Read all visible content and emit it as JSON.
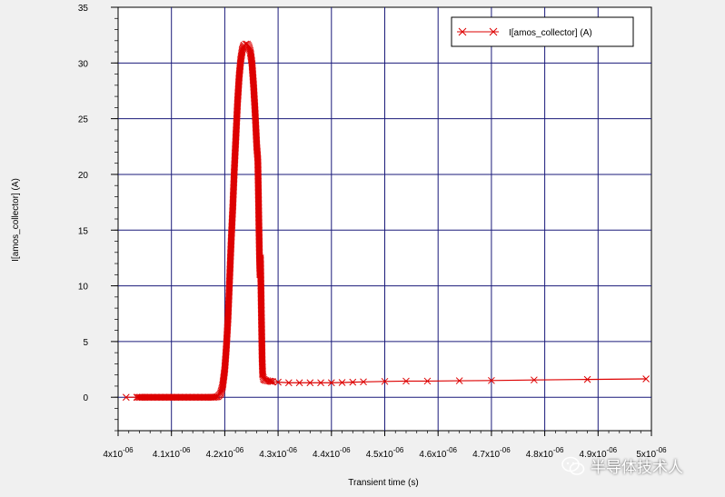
{
  "chart_data": {
    "type": "line",
    "title": "",
    "xlabel": "Transient time (s)",
    "ylabel": "I[amos_collector] (A)",
    "xlim": [
      4e-06,
      5e-06
    ],
    "ylim": [
      -3,
      35
    ],
    "x_ticks": [
      {
        "mantissa": "4x10",
        "exp": "-06"
      },
      {
        "mantissa": "4.1x10",
        "exp": "-06"
      },
      {
        "mantissa": "4.2x10",
        "exp": "-06"
      },
      {
        "mantissa": "4.3x10",
        "exp": "-06"
      },
      {
        "mantissa": "4.4x10",
        "exp": "-06"
      },
      {
        "mantissa": "4.5x10",
        "exp": "-06"
      },
      {
        "mantissa": "4.6x10",
        "exp": "-06"
      },
      {
        "mantissa": "4.7x10",
        "exp": "-06"
      },
      {
        "mantissa": "4.8x10",
        "exp": "-06"
      },
      {
        "mantissa": "4.9x10",
        "exp": "-06"
      },
      {
        "mantissa": "5x10",
        "exp": "-06"
      }
    ],
    "y_ticks": [
      "0",
      "5",
      "10",
      "15",
      "20",
      "25",
      "30",
      "35"
    ],
    "grid": true,
    "legend": "top-right",
    "series": [
      {
        "name": "I[amos_collector] (A)",
        "color": "#dd0000",
        "marker": "x",
        "points": [
          [
            4.015e-06,
            0.0
          ],
          [
            4.035e-06,
            0.0
          ],
          [
            4.05e-06,
            0.0
          ],
          [
            4.07e-06,
            0.0
          ],
          [
            4.09e-06,
            0.0
          ],
          [
            4.11e-06,
            0.0
          ],
          [
            4.13e-06,
            0.0
          ],
          [
            4.15e-06,
            0.0
          ],
          [
            4.17e-06,
            0.0
          ],
          [
            4.18e-06,
            0.0
          ],
          [
            4.187e-06,
            0.05
          ],
          [
            4.192e-06,
            0.3
          ],
          [
            4.196e-06,
            1.0
          ],
          [
            4.2e-06,
            2.5
          ],
          [
            4.203e-06,
            4.5
          ],
          [
            4.206e-06,
            7.0
          ],
          [
            4.209e-06,
            10.5
          ],
          [
            4.212e-06,
            14.0
          ],
          [
            4.215e-06,
            17.0
          ],
          [
            4.218e-06,
            20.5
          ],
          [
            4.221e-06,
            23.5
          ],
          [
            4.224e-06,
            26.5
          ],
          [
            4.227e-06,
            28.8
          ],
          [
            4.23e-06,
            30.3
          ],
          [
            4.233e-06,
            31.2
          ],
          [
            4.236e-06,
            31.6
          ],
          [
            4.239e-06,
            31.7
          ],
          [
            4.242e-06,
            31.7
          ],
          [
            4.245e-06,
            31.5
          ],
          [
            4.248e-06,
            31.0
          ],
          [
            4.251e-06,
            30.0
          ],
          [
            4.254e-06,
            28.0
          ],
          [
            4.257e-06,
            25.5
          ],
          [
            4.26e-06,
            22.5
          ],
          [
            4.262e-06,
            21.3
          ],
          [
            4.263e-06,
            18.5
          ],
          [
            4.264e-06,
            15.5
          ],
          [
            4.265e-06,
            12.8
          ],
          [
            4.266e-06,
            11.0
          ],
          [
            4.267e-06,
            12.5
          ],
          [
            4.268e-06,
            9.5
          ],
          [
            4.269e-06,
            6.5
          ],
          [
            4.27e-06,
            3.5
          ],
          [
            4.271e-06,
            2.0
          ],
          [
            4.273e-06,
            1.6
          ],
          [
            4.277e-06,
            1.5
          ],
          [
            4.283e-06,
            1.45
          ],
          [
            4.29e-06,
            1.4
          ],
          [
            4.3e-06,
            1.35
          ],
          [
            4.32e-06,
            1.3
          ],
          [
            4.34e-06,
            1.3
          ],
          [
            4.36e-06,
            1.3
          ],
          [
            4.38e-06,
            1.3
          ],
          [
            4.4e-06,
            1.3
          ],
          [
            4.42e-06,
            1.32
          ],
          [
            4.44e-06,
            1.35
          ],
          [
            4.46e-06,
            1.38
          ],
          [
            4.5e-06,
            1.42
          ],
          [
            4.54e-06,
            1.45
          ],
          [
            4.58e-06,
            1.45
          ],
          [
            4.64e-06,
            1.48
          ],
          [
            4.7e-06,
            1.5
          ],
          [
            4.78e-06,
            1.55
          ],
          [
            4.88e-06,
            1.6
          ],
          [
            4.99e-06,
            1.65
          ]
        ]
      }
    ]
  },
  "watermark": {
    "text": "半导体技术人",
    "icon": "wechat-icon"
  },
  "colors": {
    "background": "#f0f0f0",
    "plot_area": "#ffffff",
    "grid": "#1a1a7a",
    "series": "#dd0000"
  }
}
